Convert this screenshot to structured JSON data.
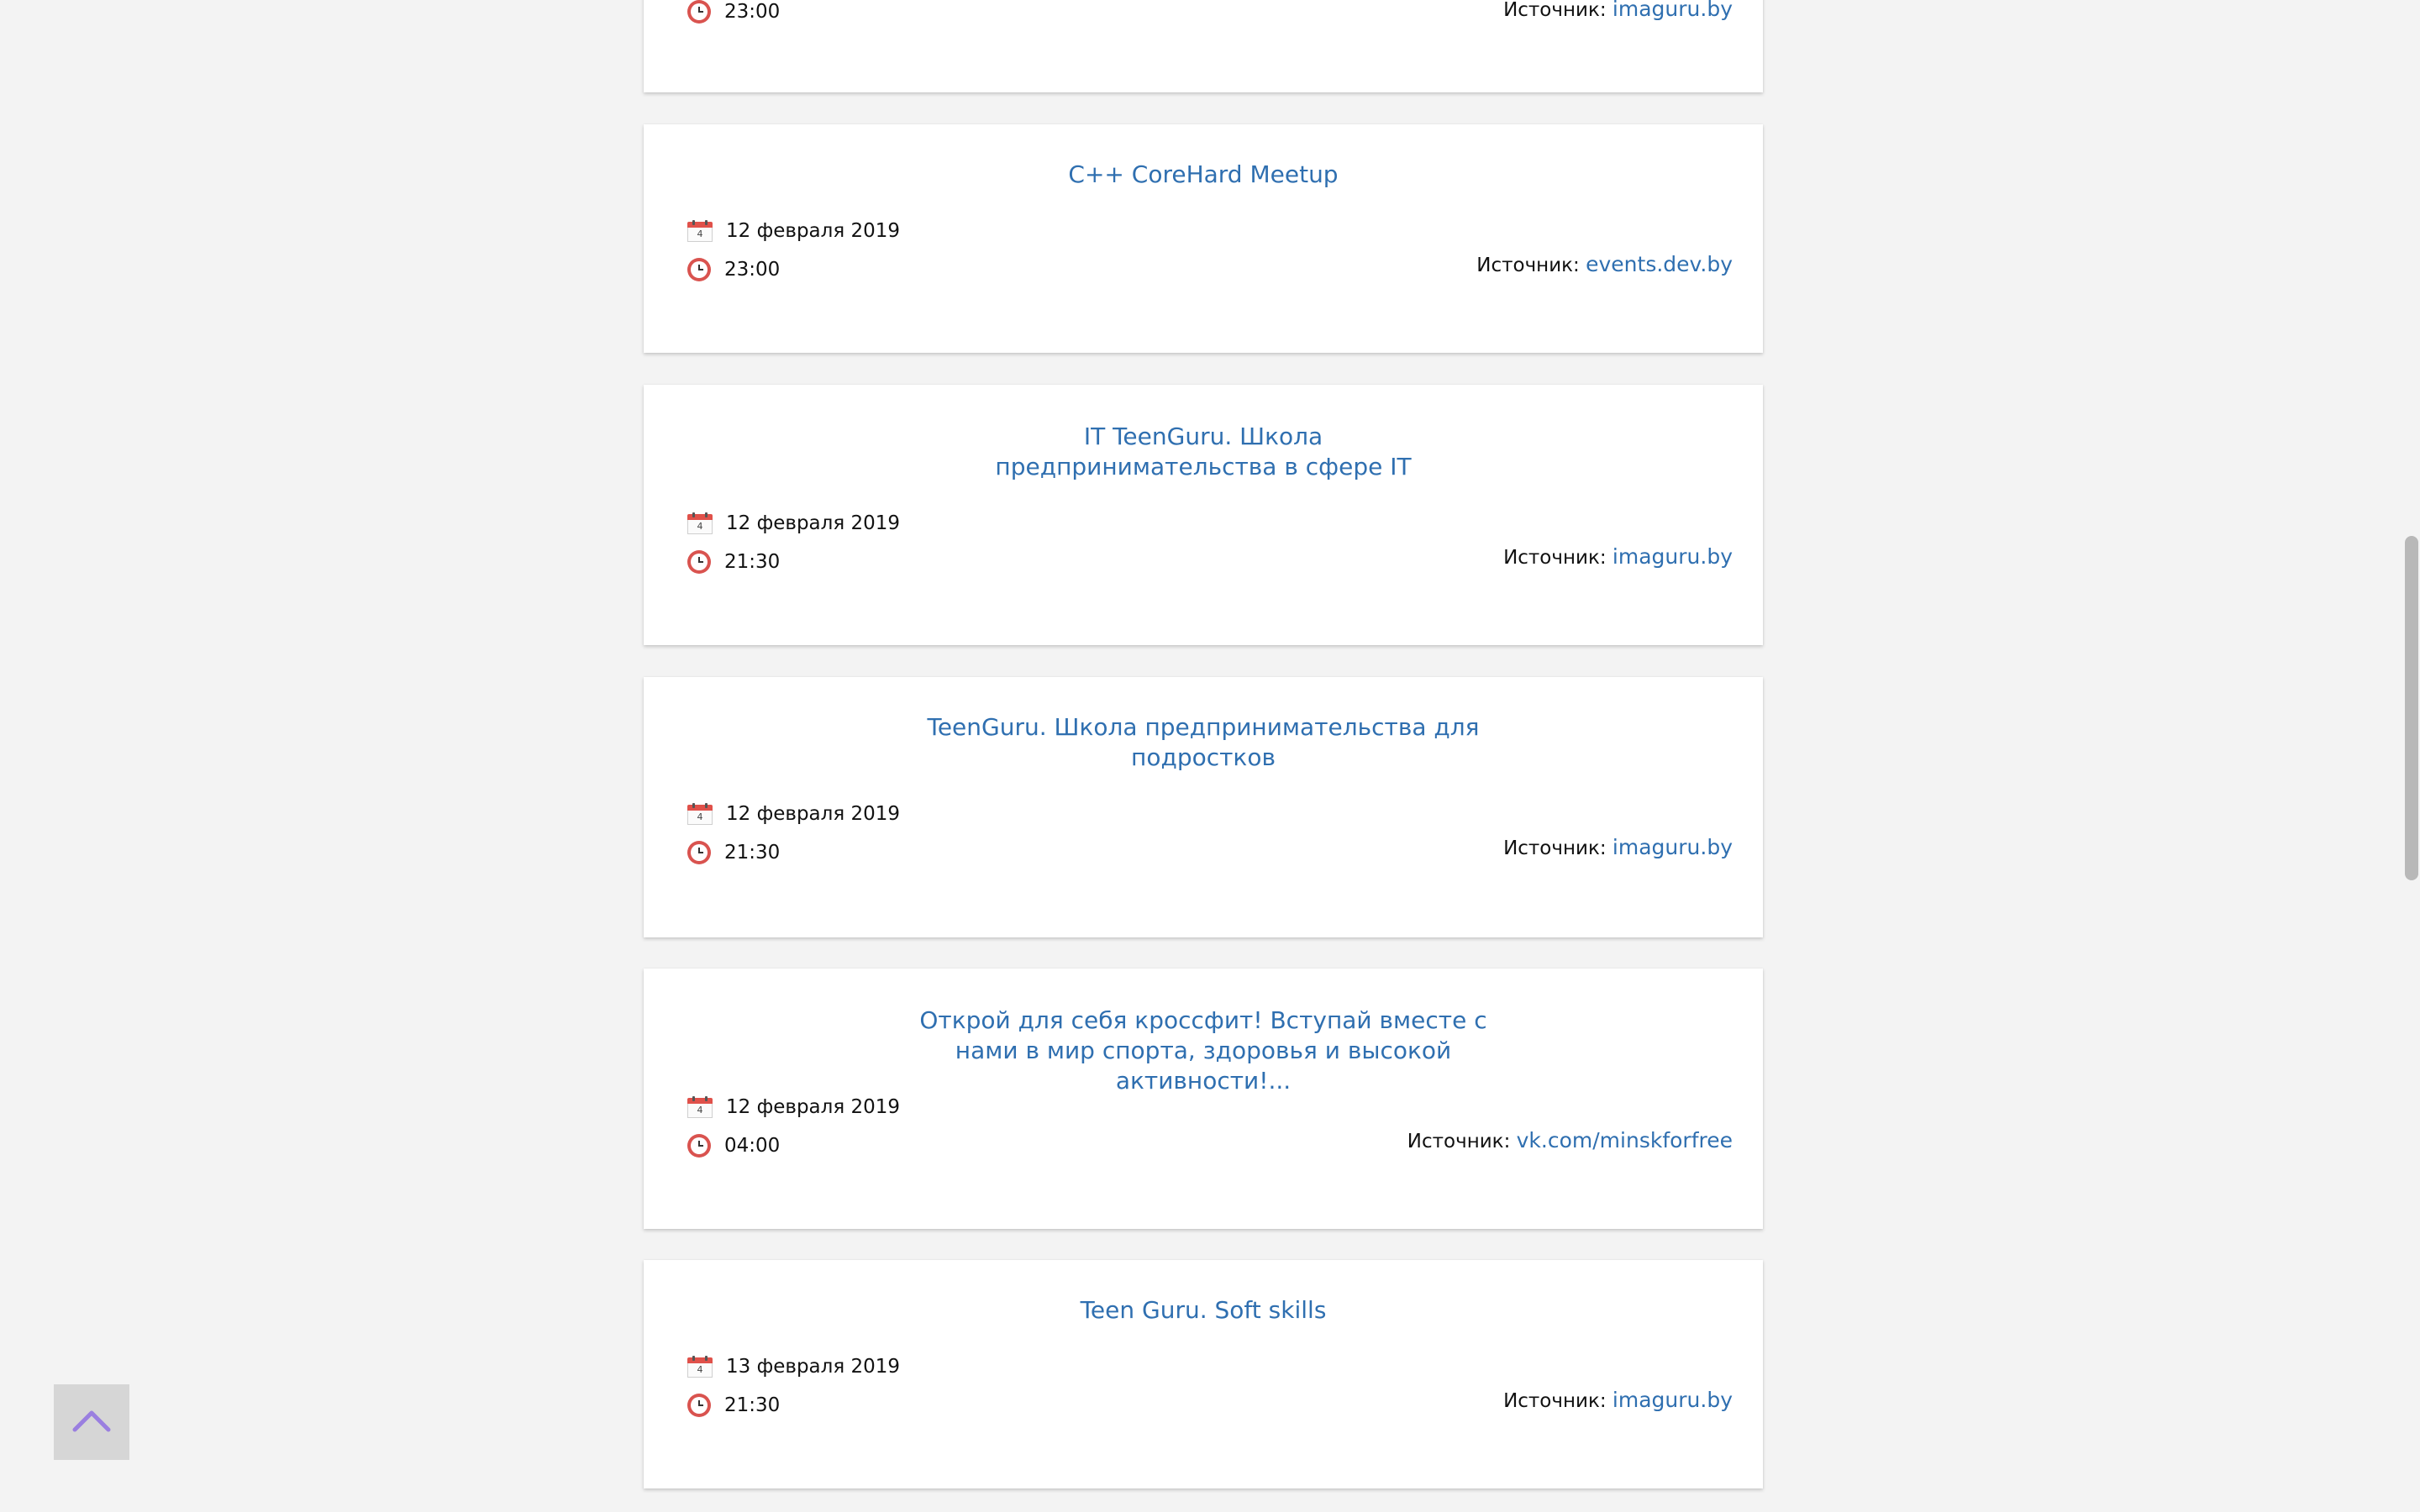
{
  "source_prefix": "Источник:",
  "cards": [
    {
      "title": "",
      "date": "",
      "time": "23:00",
      "source": "imaguru.by"
    },
    {
      "title": "C++ CoreHard Meetup",
      "date": "12 февраля 2019",
      "time": "23:00",
      "source": "events.dev.by"
    },
    {
      "title": "IT TeenGuru. Школа предпринимательства в сфере IT",
      "date": "12 февраля 2019",
      "time": "21:30",
      "source": "imaguru.by"
    },
    {
      "title": "TeenGuru. Школа предпринимательства для подростков",
      "date": "12 февраля 2019",
      "time": "21:30",
      "source": "imaguru.by"
    },
    {
      "title": "Открой для себя кроссфит! Вступай вместе с нами в мир спорта, здоровья и высокой активности!...",
      "date": "12 февраля 2019",
      "time": "04:00",
      "source": "vk.com/minskforfree"
    },
    {
      "title": "Teen Guru. Soft skills",
      "date": "13 февраля 2019",
      "time": "21:30",
      "source": "imaguru.by"
    }
  ],
  "calendar_day": "4",
  "icons": {
    "date": "calendar-icon",
    "time": "clock-icon",
    "scroll_top": "chevron-up-icon"
  },
  "colors": {
    "link": "#2f6fb0",
    "background": "#f3f3f3",
    "card": "#ffffff",
    "scroll_top_button": "#d6d6d6",
    "scroll_top_chevron": "#9a7fe0"
  }
}
